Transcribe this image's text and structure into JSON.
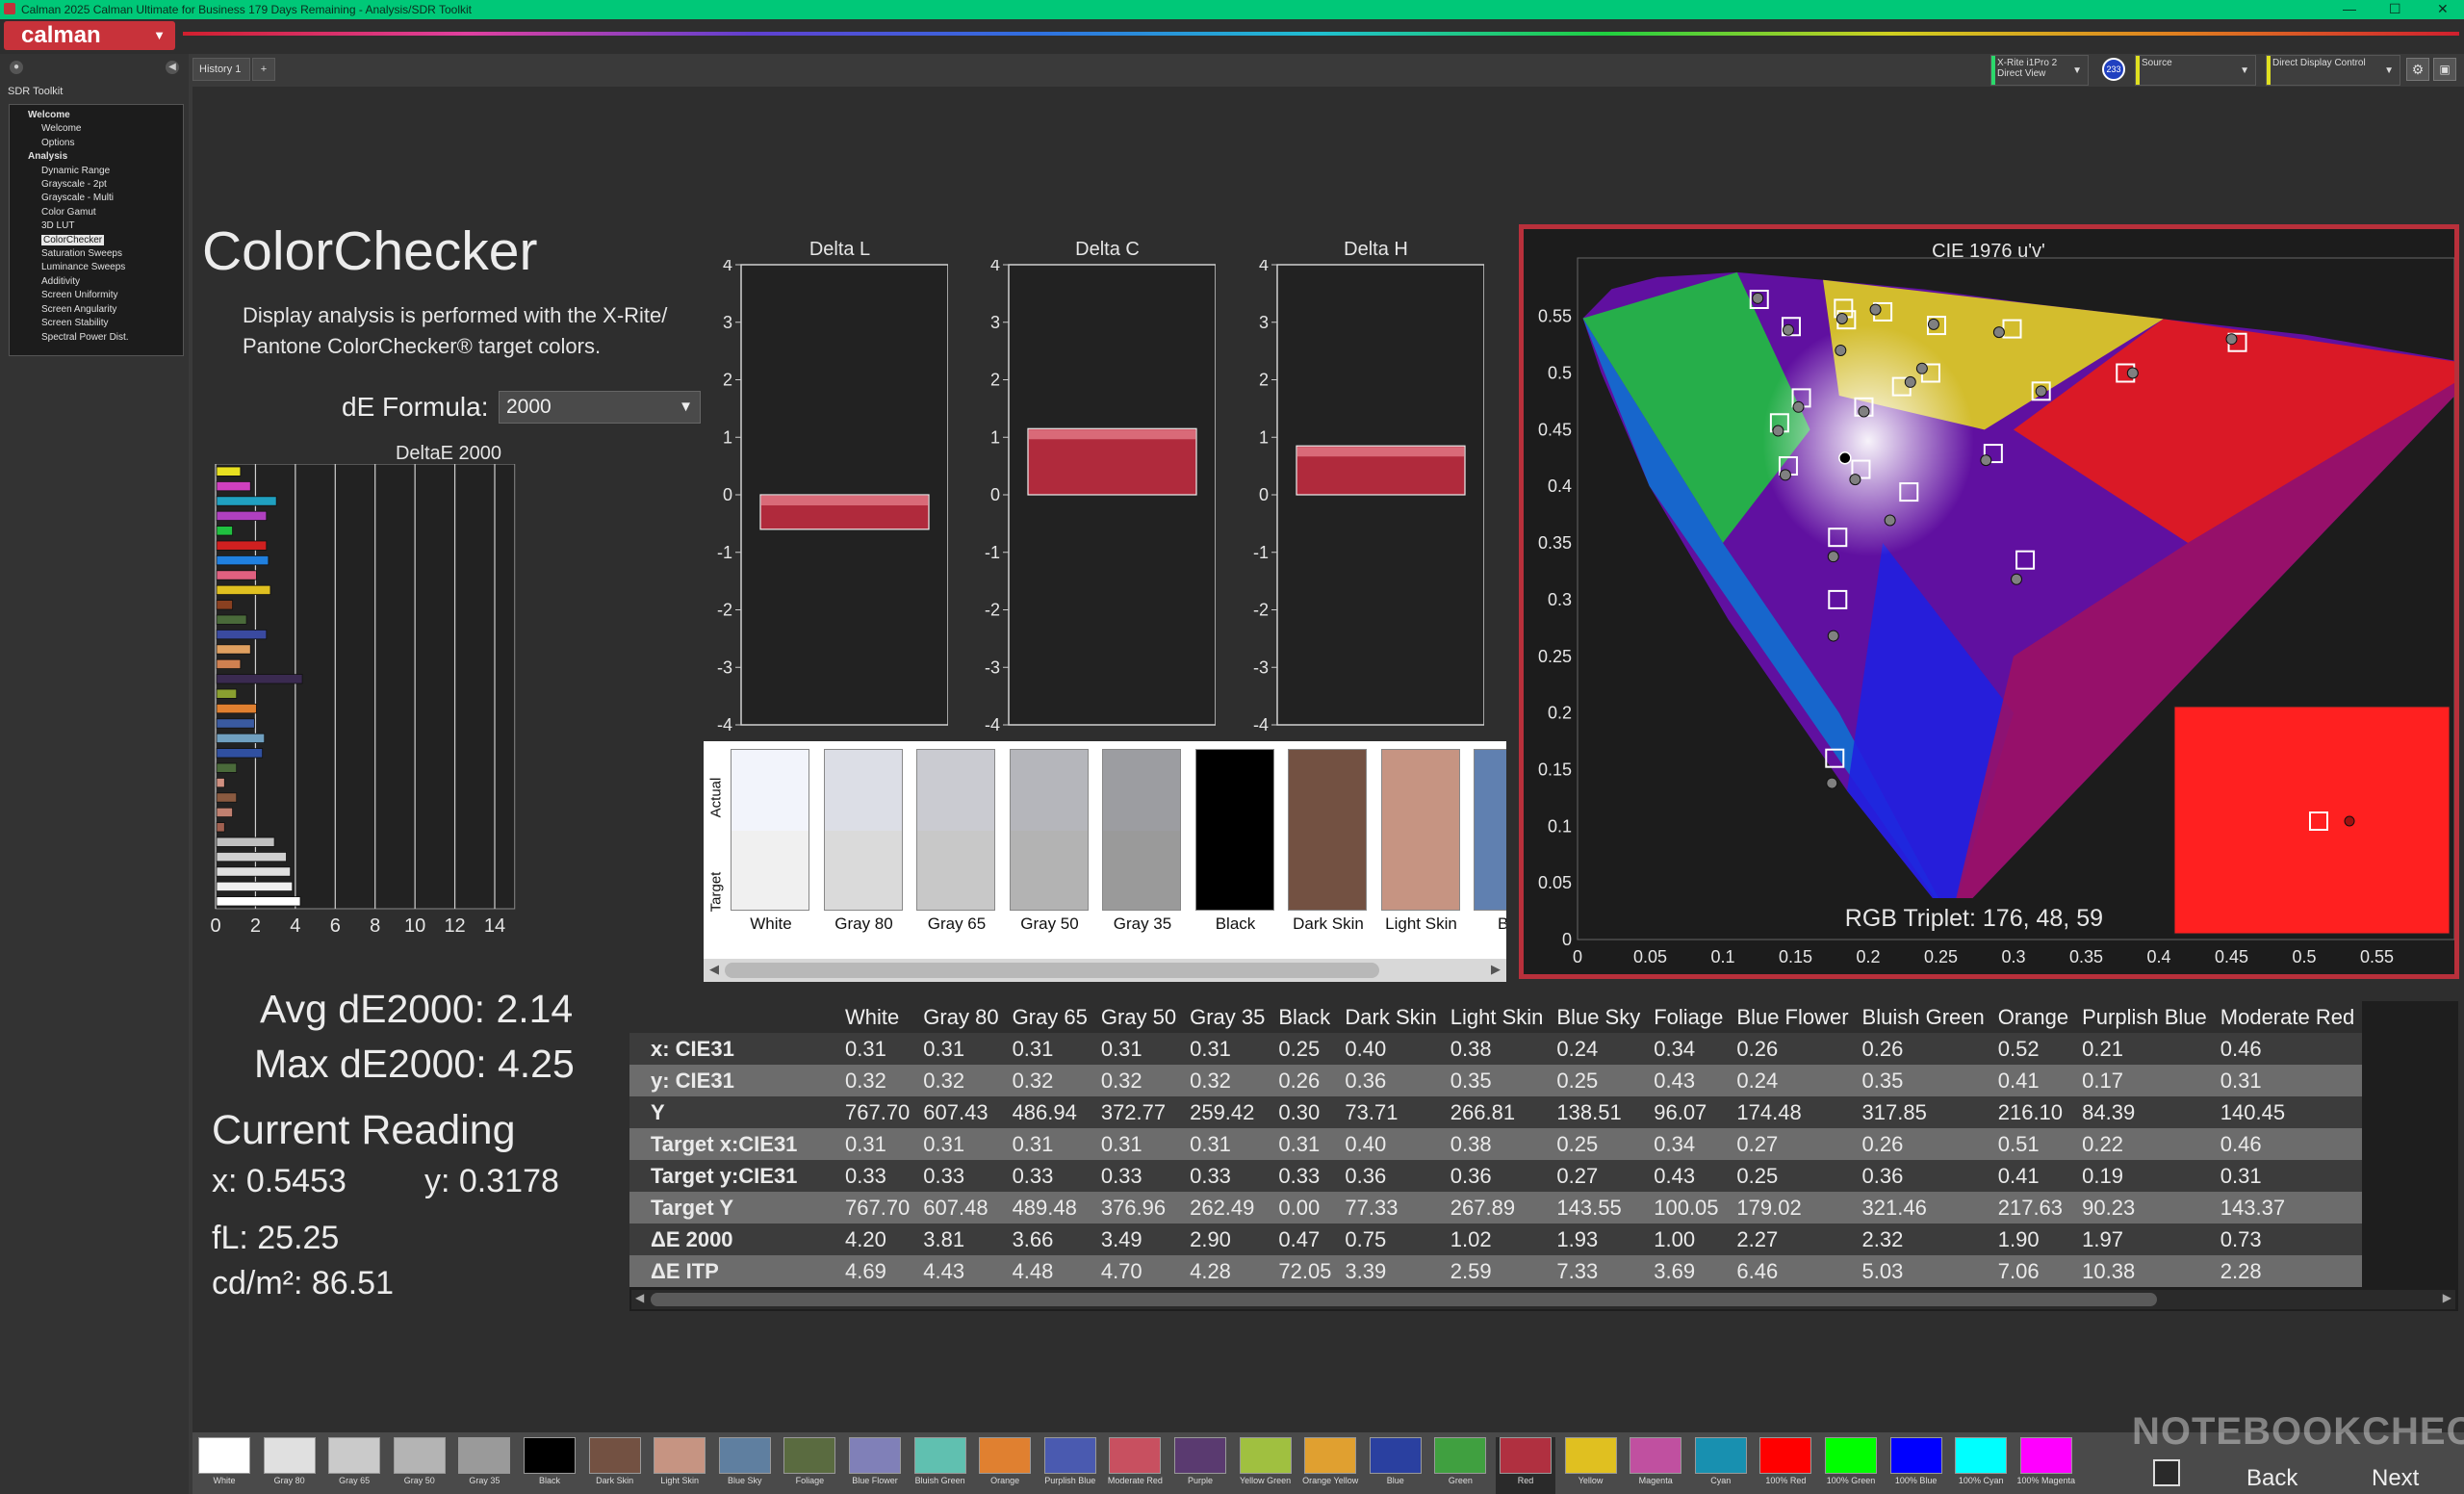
{
  "window": {
    "title": "Calman 2025 Calman Ultimate for Business 179 Days Remaining  - Analysis/SDR Toolkit",
    "minimize": "—",
    "maximize": "☐",
    "close": "✕"
  },
  "app": {
    "logo": "calman",
    "logo_caret": "▼"
  },
  "sidebar": {
    "toolkit_label": "SDR Toolkit",
    "items": [
      {
        "label": "Welcome",
        "level": 0
      },
      {
        "label": "Welcome",
        "level": 1
      },
      {
        "label": "Options",
        "level": 1
      },
      {
        "label": "Analysis",
        "level": 0
      },
      {
        "label": "Dynamic Range",
        "level": 1
      },
      {
        "label": "Grayscale - 2pt",
        "level": 1
      },
      {
        "label": "Grayscale - Multi",
        "level": 1
      },
      {
        "label": "Color Gamut",
        "level": 1
      },
      {
        "label": "3D LUT",
        "level": 1
      },
      {
        "label": "ColorChecker",
        "level": 1,
        "selected": true
      },
      {
        "label": "Saturation Sweeps",
        "level": 1
      },
      {
        "label": "Luminance Sweeps",
        "level": 1
      },
      {
        "label": "Additivity",
        "level": 1
      },
      {
        "label": "Screen Uniformity",
        "level": 1
      },
      {
        "label": "Screen Angularity",
        "level": 1
      },
      {
        "label": "Screen Stability",
        "level": 1
      },
      {
        "label": "Spectral Power Dist.",
        "level": 1
      }
    ]
  },
  "tabs": {
    "history": "History 1",
    "add": "+"
  },
  "topbar": {
    "meter": {
      "line1": "X-Rite i1Pro 2",
      "line2": "Direct View",
      "badge": "233",
      "color": "#2bd96b"
    },
    "source": {
      "label": "Source",
      "color": "#e0e020"
    },
    "display": {
      "label": "Direct Display Control",
      "color": "#e0e020"
    }
  },
  "page": {
    "title": "ColorChecker",
    "description": "Display analysis is performed with the X-Rite/ Pantone ColorChecker® target colors.",
    "formula_label": "dE Formula:",
    "formula_value": "2000"
  },
  "stats": {
    "avg": "Avg dE2000: 2.14",
    "max": "Max dE2000: 4.25",
    "current_title": "Current Reading",
    "x": "x: 0.5453",
    "y": "y: 0.3178",
    "fl": "fL: 25.25",
    "cdm2": "cd/m²: 86.51"
  },
  "chart_data": [
    {
      "type": "bar",
      "title": "DeltaE 2000",
      "orientation": "horizontal",
      "xlim": [
        0,
        15
      ],
      "xticks": [
        "0",
        "2",
        "4",
        "6",
        "8",
        "10",
        "12",
        "14"
      ],
      "values": [
        1.2,
        1.7,
        3.0,
        2.5,
        0.8,
        2.5,
        2.6,
        2.0,
        2.7,
        0.8,
        1.5,
        2.5,
        1.7,
        1.2,
        4.3,
        1.0,
        2.0,
        1.9,
        2.4,
        2.3,
        1.0,
        0.4,
        1.0,
        0.8,
        0.4,
        2.9,
        3.5,
        3.7,
        3.8,
        4.2
      ],
      "colors": [
        "#e8e020",
        "#d040c0",
        "#20a0c0",
        "#b040c0",
        "#20c040",
        "#d02020",
        "#2080e0",
        "#e06080",
        "#e0c020",
        "#8a4020",
        "#4a6a3a",
        "#3a4aa0",
        "#e0a060",
        "#d08050",
        "#3a2a50",
        "#8aa030",
        "#e08030",
        "#3a5aa0",
        "#70a0c0",
        "#3050a0",
        "#4a6a3a",
        "#d09080",
        "#8a5a40",
        "#c08070",
        "#a06050",
        "#c0c0c0",
        "#d0d0d0",
        "#e0e0e0",
        "#f0f0f0",
        "#ffffff"
      ]
    },
    {
      "type": "bar",
      "title": "Delta L",
      "ylim": [
        -4,
        4
      ],
      "yticks": [
        "4",
        "3",
        "2",
        "1",
        "0",
        "-1",
        "-2",
        "-3",
        "-4"
      ],
      "values": [
        -0.6
      ]
    },
    {
      "type": "bar",
      "title": "Delta C",
      "ylim": [
        -4,
        4
      ],
      "yticks": [
        "4",
        "3",
        "2",
        "1",
        "0",
        "-1",
        "-2",
        "-3",
        "-4"
      ],
      "values": [
        1.15
      ]
    },
    {
      "type": "bar",
      "title": "Delta H",
      "ylim": [
        -4,
        4
      ],
      "yticks": [
        "4",
        "3",
        "2",
        "1",
        "0",
        "-1",
        "-2",
        "-3",
        "-4"
      ],
      "values": [
        0.85
      ]
    },
    {
      "type": "scatter",
      "title": "CIE 1976 u'v'",
      "xlim": [
        0,
        0.6
      ],
      "ylim": [
        0,
        0.6
      ],
      "xticks": [
        "0",
        "0.05",
        "0.1",
        "0.15",
        "0.2",
        "0.25",
        "0.3",
        "0.35",
        "0.4",
        "0.45",
        "0.5",
        "0.55"
      ],
      "yticks": [
        "0",
        "0.05",
        "0.1",
        "0.15",
        "0.2",
        "0.25",
        "0.3",
        "0.35",
        "0.4",
        "0.45",
        "0.5",
        "0.55"
      ],
      "targets": [
        [
          0.125,
          0.565
        ],
        [
          0.147,
          0.541
        ],
        [
          0.183,
          0.557
        ],
        [
          0.185,
          0.547
        ],
        [
          0.21,
          0.554
        ],
        [
          0.247,
          0.542
        ],
        [
          0.299,
          0.539
        ],
        [
          0.454,
          0.527
        ],
        [
          0.377,
          0.5
        ],
        [
          0.319,
          0.484
        ],
        [
          0.243,
          0.5
        ],
        [
          0.223,
          0.488
        ],
        [
          0.197,
          0.47
        ],
        [
          0.154,
          0.478
        ],
        [
          0.139,
          0.456
        ],
        [
          0.145,
          0.418
        ],
        [
          0.195,
          0.415
        ],
        [
          0.286,
          0.429
        ],
        [
          0.228,
          0.395
        ],
        [
          0.179,
          0.355
        ],
        [
          0.179,
          0.3
        ],
        [
          0.308,
          0.335
        ],
        [
          0.177,
          0.16
        ]
      ],
      "measured": [
        [
          0.124,
          0.566
        ],
        [
          0.145,
          0.538
        ],
        [
          0.182,
          0.548
        ],
        [
          0.181,
          0.52
        ],
        [
          0.205,
          0.556
        ],
        [
          0.245,
          0.543
        ],
        [
          0.29,
          0.536
        ],
        [
          0.45,
          0.53
        ],
        [
          0.382,
          0.5
        ],
        [
          0.319,
          0.484
        ],
        [
          0.237,
          0.504
        ],
        [
          0.229,
          0.492
        ],
        [
          0.197,
          0.466
        ],
        [
          0.152,
          0.47
        ],
        [
          0.138,
          0.449
        ],
        [
          0.143,
          0.41
        ],
        [
          0.191,
          0.406
        ],
        [
          0.281,
          0.423
        ],
        [
          0.215,
          0.37
        ],
        [
          0.176,
          0.338
        ],
        [
          0.176,
          0.268
        ],
        [
          0.302,
          0.318
        ],
        [
          0.175,
          0.138
        ]
      ],
      "current_reading": {
        "u": 0.184,
        "v": 0.425
      },
      "swatch_label": "RGB Triplet: 176, 48, 59",
      "swatch_color": "#ff2020"
    },
    {
      "type": "table",
      "columns": [
        "White",
        "Gray 80",
        "Gray 65",
        "Gray 50",
        "Gray 35",
        "Black",
        "Dark Skin",
        "Light Skin",
        "Blue Sky",
        "Foliage",
        "Blue Flower",
        "Bluish Green",
        "Orange",
        "Purplish Blue",
        "Moderate Red"
      ],
      "rows": [
        {
          "label": "x: CIE31",
          "values": [
            "0.31",
            "0.31",
            "0.31",
            "0.31",
            "0.31",
            "0.25",
            "0.40",
            "0.38",
            "0.24",
            "0.34",
            "0.26",
            "0.26",
            "0.52",
            "0.21",
            "0.46"
          ]
        },
        {
          "label": "y: CIE31",
          "values": [
            "0.32",
            "0.32",
            "0.32",
            "0.32",
            "0.32",
            "0.26",
            "0.36",
            "0.35",
            "0.25",
            "0.43",
            "0.24",
            "0.35",
            "0.41",
            "0.17",
            "0.31"
          ]
        },
        {
          "label": "Y",
          "values": [
            "767.70",
            "607.43",
            "486.94",
            "372.77",
            "259.42",
            "0.30",
            "73.71",
            "266.81",
            "138.51",
            "96.07",
            "174.48",
            "317.85",
            "216.10",
            "84.39",
            "140.45"
          ]
        },
        {
          "label": "Target x:CIE31",
          "values": [
            "0.31",
            "0.31",
            "0.31",
            "0.31",
            "0.31",
            "0.31",
            "0.40",
            "0.38",
            "0.25",
            "0.34",
            "0.27",
            "0.26",
            "0.51",
            "0.22",
            "0.46"
          ]
        },
        {
          "label": "Target y:CIE31",
          "values": [
            "0.33",
            "0.33",
            "0.33",
            "0.33",
            "0.33",
            "0.33",
            "0.36",
            "0.36",
            "0.27",
            "0.43",
            "0.25",
            "0.36",
            "0.41",
            "0.19",
            "0.31"
          ]
        },
        {
          "label": "Target Y",
          "values": [
            "767.70",
            "607.48",
            "489.48",
            "376.96",
            "262.49",
            "0.00",
            "77.33",
            "267.89",
            "143.55",
            "100.05",
            "179.02",
            "321.46",
            "217.63",
            "90.23",
            "143.37"
          ]
        },
        {
          "label": "ΔE 2000",
          "values": [
            "4.20",
            "3.81",
            "3.66",
            "3.49",
            "2.90",
            "0.47",
            "0.75",
            "1.02",
            "1.93",
            "1.00",
            "2.27",
            "2.32",
            "1.90",
            "1.97",
            "0.73"
          ]
        },
        {
          "label": "ΔE ITP",
          "values": [
            "4.69",
            "4.43",
            "4.48",
            "4.70",
            "4.28",
            "72.05",
            "3.39",
            "2.59",
            "7.33",
            "3.69",
            "6.46",
            "5.03",
            "7.06",
            "10.38",
            "2.28"
          ]
        }
      ]
    }
  ],
  "patches": {
    "label_actual": "Actual",
    "label_target": "Target",
    "items": [
      {
        "name": "White",
        "actual": "#f2f4fb",
        "target": "#f0f0f0"
      },
      {
        "name": "Gray 80",
        "actual": "#dcdee6",
        "target": "#dadada"
      },
      {
        "name": "Gray 65",
        "actual": "#cacbd1",
        "target": "#c8c8c8"
      },
      {
        "name": "Gray 50",
        "actual": "#b5b6bb",
        "target": "#b3b3b3"
      },
      {
        "name": "Gray 35",
        "actual": "#9c9da1",
        "target": "#9a9a9a"
      },
      {
        "name": "Black",
        "actual": "#000000",
        "target": "#000000"
      },
      {
        "name": "Dark Skin",
        "actual": "#735142",
        "target": "#735142"
      },
      {
        "name": "Light Skin",
        "actual": "#c69482",
        "target": "#c69482"
      },
      {
        "name": "Blue",
        "actual": "#6080b0",
        "target": "#6080b0"
      }
    ]
  },
  "bottom_bar": {
    "swatches": [
      {
        "name": "White",
        "color": "#ffffff"
      },
      {
        "name": "Gray 80",
        "color": "#e0e0e0"
      },
      {
        "name": "Gray 65",
        "color": "#cacaca"
      },
      {
        "name": "Gray 50",
        "color": "#b4b4b4"
      },
      {
        "name": "Gray 35",
        "color": "#9a9a9a"
      },
      {
        "name": "Black",
        "color": "#000000"
      },
      {
        "name": "Dark Skin",
        "color": "#735142"
      },
      {
        "name": "Light Skin",
        "color": "#c69482"
      },
      {
        "name": "Blue Sky",
        "color": "#5f7fa0"
      },
      {
        "name": "Foliage",
        "color": "#5a6b40"
      },
      {
        "name": "Blue Flower",
        "color": "#8080b8"
      },
      {
        "name": "Bluish Green",
        "color": "#60c0b0"
      },
      {
        "name": "Orange",
        "color": "#e08030"
      },
      {
        "name": "Purplish Blue",
        "color": "#4a5ab0"
      },
      {
        "name": "Moderate Red",
        "color": "#c85060"
      },
      {
        "name": "Purple",
        "color": "#5a3a70"
      },
      {
        "name": "Yellow Green",
        "color": "#a0c040"
      },
      {
        "name": "Orange Yellow",
        "color": "#e0a030"
      },
      {
        "name": "Blue",
        "color": "#2a40a0"
      },
      {
        "name": "Green",
        "color": "#40a040"
      },
      {
        "name": "Red",
        "color": "#b03040",
        "active": true
      },
      {
        "name": "Yellow",
        "color": "#e0c020"
      },
      {
        "name": "Magenta",
        "color": "#c050a0"
      },
      {
        "name": "Cyan",
        "color": "#1890b0"
      },
      {
        "name": "100% Red",
        "color": "#ff0000"
      },
      {
        "name": "100% Green",
        "color": "#00ff00"
      },
      {
        "name": "100% Blue",
        "color": "#0000ff"
      },
      {
        "name": "100% Cyan",
        "color": "#00ffff"
      },
      {
        "name": "100% Magenta",
        "color": "#ff00ff"
      }
    ],
    "back": "Back",
    "next": "Next"
  },
  "watermark": "NOTEBOOKCHECK"
}
